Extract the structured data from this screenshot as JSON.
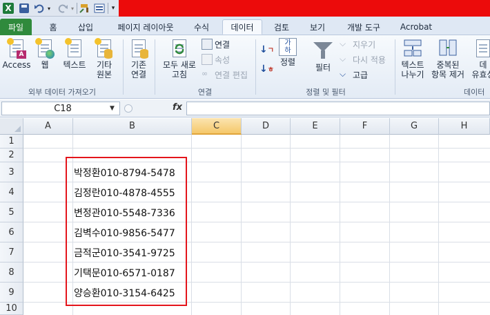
{
  "qat": {
    "excel_logo": "X",
    "icons": [
      "excel-logo-icon",
      "save-icon",
      "undo-icon",
      "redo-icon",
      "format-painter-icon",
      "form-icon",
      "customize-qat-icon"
    ]
  },
  "tabs": [
    {
      "label": "파일"
    },
    {
      "label": "홈"
    },
    {
      "label": "삽입"
    },
    {
      "label": "페이지 레이아웃"
    },
    {
      "label": "수식"
    },
    {
      "label": "데이터"
    },
    {
      "label": "검토"
    },
    {
      "label": "보기"
    },
    {
      "label": "개발 도구"
    },
    {
      "label": "Acrobat"
    }
  ],
  "ribbon": {
    "get_external": {
      "access": "Access",
      "web": "웹",
      "text": "텍스트",
      "other_1": "기타",
      "other_2": "원본",
      "group_label": "외부 데이터 가져오기"
    },
    "existing_1": "기존",
    "existing_2": "연결",
    "connections": {
      "refresh_1": "모두 새로",
      "refresh_2": "고침",
      "connections": "연결",
      "properties": "속성",
      "edit_links": "연결 편집",
      "group_label": "연결"
    },
    "sort_filter": {
      "sort": "정렬",
      "filter": "필터",
      "clear": "지우기",
      "reapply": "다시 적용",
      "advanced": "고급",
      "sort_icon_text": "가\n하",
      "group_label": "정렬 및 필터"
    },
    "data_tools": {
      "text_to_cols_1": "텍스트",
      "text_to_cols_2": "나누기",
      "remove_dup_1": "중복된",
      "remove_dup_2": "항목 제거",
      "validation_1": "데",
      "validation_2": "유효성",
      "group_label": "데이터"
    }
  },
  "formula_bar": {
    "name_box": "C18",
    "fx": "fx",
    "formula": ""
  },
  "grid": {
    "columns": [
      "A",
      "B",
      "C",
      "D",
      "E",
      "F",
      "G",
      "H"
    ],
    "selected_column": "C",
    "rows": [
      "1",
      "2",
      "3",
      "4",
      "5",
      "6",
      "7",
      "8",
      "9",
      "10"
    ],
    "b_values": [
      "박정환010-8794-5478",
      "김정란010-4878-4555",
      "변정관010-5548-7336",
      "김벽수010-9856-5477",
      "금적군010-3541-9725",
      "기택문010-6571-0187",
      "양승환010-3154-6425"
    ]
  },
  "colors": {
    "file_tab": "#2f8a3c",
    "title_bar_highlight": "#ec0b0b",
    "highlight_box": "#e4141b",
    "selected_header": "#f5c86a"
  }
}
